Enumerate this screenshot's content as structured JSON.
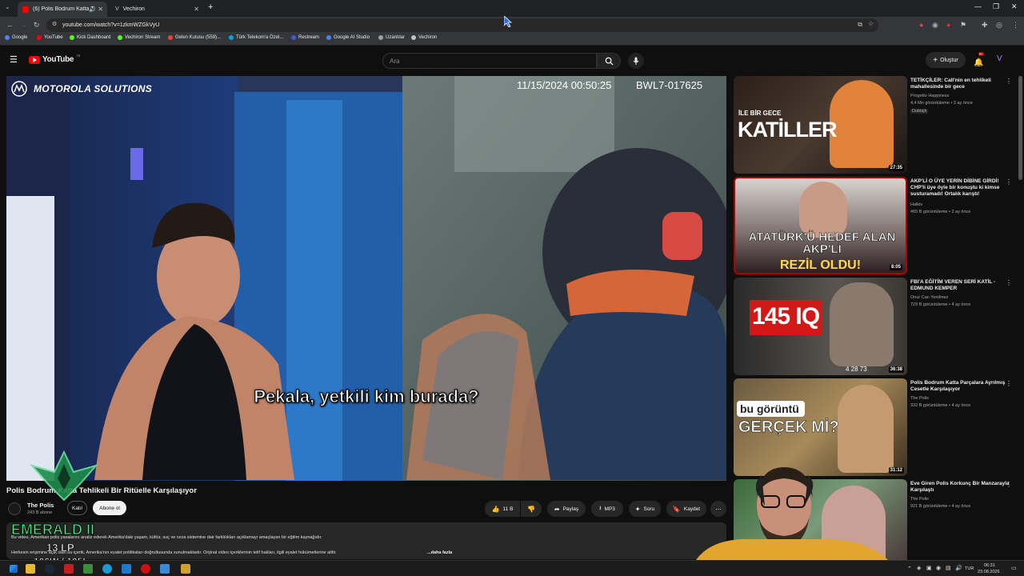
{
  "browser": {
    "tabs": [
      {
        "label": "(6) Polis Bodrum Katta Tehl",
        "active": true
      },
      {
        "label": "Vechiron",
        "active": false
      }
    ],
    "new_tab": "+",
    "url": "youtube.com/watch?v=1zkmWZGkVyU",
    "bookmarks": [
      {
        "label": "Google",
        "color": "#4285f4"
      },
      {
        "label": "YouTube",
        "color": "#ff0000"
      },
      {
        "label": "Kick Dashboard",
        "color": "#53fc18"
      },
      {
        "label": "Vechiron Stream",
        "color": "#53fc18"
      },
      {
        "label": "Gelen Kutusu (559)...",
        "color": "#ea4335"
      },
      {
        "label": "Türk Telekom'a Özel...",
        "color": "#00a3e0"
      },
      {
        "label": "Restream",
        "color": "#3b5bdb"
      },
      {
        "label": "Google AI Studio",
        "color": "#4285f4"
      },
      {
        "label": "Uzantılar",
        "color": "#9aa0a6"
      },
      {
        "label": "Vechiron",
        "color": "#c0c0c0"
      }
    ]
  },
  "yt": {
    "logo": "YouTube",
    "country": "TR",
    "search_placeholder": "Ara",
    "create_label": "Oluştur",
    "notif_count": "9+"
  },
  "video": {
    "brand": "MOTOROLA SOLUTIONS",
    "timestamp": "11/15/2024 00:50:25",
    "device_id": "BWL7-017625",
    "subtitle": "Pekala, yetkili kim burada?"
  },
  "info": {
    "title": "Polis Bodrum Katta Tehlikeli Bir Ritüelle Karşılaşıyor",
    "channel": "The Polis",
    "subscribers": "243 B abone",
    "join_label": "Katıl",
    "subscribe_label": "Abone ol",
    "likes": "11 B",
    "share_label": "Paylaş",
    "mp3_label": "MP3",
    "ask_label": "Soru",
    "save_label": "Kaydet",
    "desc_line1": "Bu video, Amerikan polis yasalarını analiz ederek Amerika'daki yaşam, kültür, suç ve ceza sistemine dair farklılıkları açıklamayı amaçlayan bir eğitim kaynağıdır.",
    "desc_line2": "Herkesin erişimine açık olan bu içerik, Amerika'nın eyalet politikaları doğrultusunda sunulmaktadır. Orijinal video içeriklerinin telif hakları, ilgili eyalet hükümetlerine aittir.",
    "more_label": "...daha fazla"
  },
  "overlay": {
    "rank": "EMERALD II",
    "lp": "13 LP",
    "record": "106W / 105L"
  },
  "recommendations": [
    {
      "thumb_text": "KATİLLER",
      "thumb_small": "İLE BİR GECE",
      "duration": "27:35",
      "title": "TETİKÇİLER: Call'nin en tehlikeli mahallesinde bir gece",
      "channel": "Progetto Happiness",
      "meta": "4,4 Mn görüntüleme • 3 ay önce",
      "badge": "Dublajlı"
    },
    {
      "thumb_text": "ATATÜRK'Ü HEDEF ALAN AKP'Lİ",
      "thumb_small": "REZİL OLDU!",
      "duration": "8:05",
      "title": "AKP'Lİ O ÜYE YERİN DİBİNE GİRDİ! CHP'li üye öyle bir konuştu ki kimse susturamadı! Ortalık karıştı!",
      "channel": "Halktv",
      "meta": "465 B görüntüleme • 2 ay önce"
    },
    {
      "thumb_text": "145 IQ",
      "thumb_small": "4 28 73",
      "duration": "36:38",
      "title": "FBI'A EĞİTİM VEREN SERİ KATİL - EDMUND KEMPER",
      "channel": "Onur Can Yenilmez",
      "meta": "729 B görüntüleme • 4 ay önce"
    },
    {
      "thumb_text": "GERÇEK Mİ?",
      "thumb_small": "bu görüntü",
      "duration": "31:12",
      "title": "Polis Bodrum Katta Parçalara Ayrılmış Cesetle Karşılaşıyor",
      "channel": "The Polis",
      "meta": "332 B görüntüleme • 4 ay önce"
    },
    {
      "thumb_text": "",
      "thumb_small": "",
      "duration": "",
      "title": "Eve Giren Polis Korkunç Bir Manzarayla Karşılaştı",
      "channel": "The Polis",
      "meta": "921 B görüntüleme • 4 ay önce"
    }
  ],
  "taskbar": {
    "lang": "TUR",
    "time": "06:31",
    "date": "23.08.2026"
  }
}
